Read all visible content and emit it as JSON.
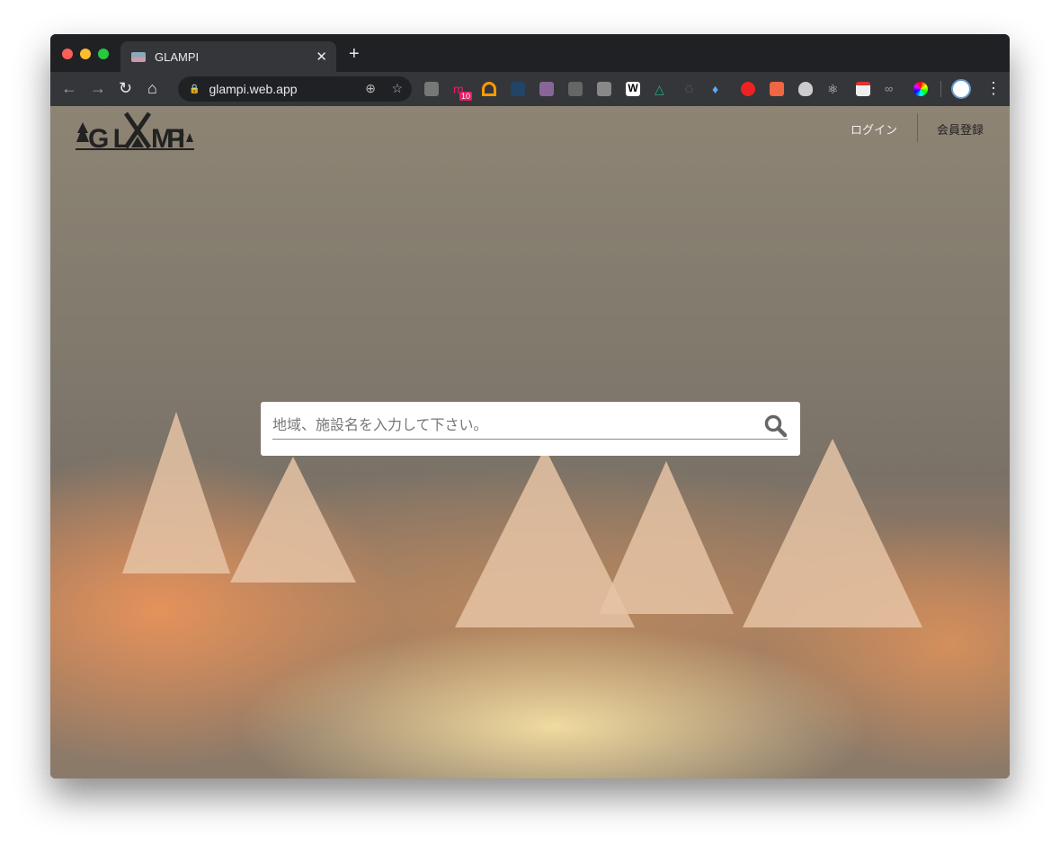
{
  "browser": {
    "tab_title": "GLAMPI",
    "url": "glampi.web.app",
    "new_tab": "+",
    "close": "✕",
    "extension_badges": {
      "badge1": "10"
    }
  },
  "site": {
    "logo": "GLAMPI",
    "nav": {
      "login": "ログイン",
      "signup": "会員登録"
    },
    "search": {
      "placeholder": "地域、施設名を入力して下さい。",
      "value": ""
    }
  },
  "colors": {
    "accent": "#333333",
    "chrome_dark": "#202124",
    "chrome_toolbar": "#35363a"
  }
}
